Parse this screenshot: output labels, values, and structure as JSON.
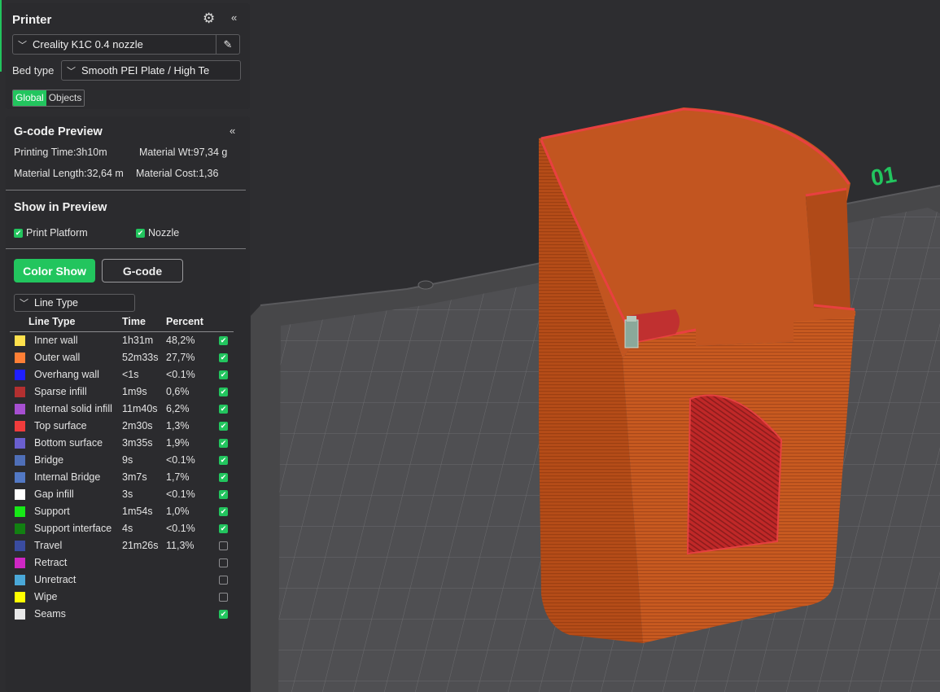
{
  "printer": {
    "title": "Printer",
    "machine": "Creality K1C 0.4 nozzle",
    "bed_type_label": "Bed type",
    "bed_type_value": "Smooth PEI Plate / High Te",
    "toggle_global": "Global",
    "toggle_objects": "Objects",
    "settings_icon": "gear-icon",
    "collapse_icon": "double-chevron-left-icon",
    "edit_icon": "pencil-icon"
  },
  "gcode": {
    "title": "G-code Preview",
    "printing_time": "Printing Time:3h10m",
    "material_wt": "Material Wt:97,34 g",
    "material_length": "Material Length:32,64 m",
    "material_cost": "Material Cost:1,36",
    "show_title": "Show in Preview",
    "print_platform": "Print Platform",
    "nozzle": "Nozzle",
    "color_show": "Color Show",
    "gcode_btn": "G-code",
    "view_select": "Line Type",
    "col_line_type": "Line Type",
    "col_time": "Time",
    "col_percent": "Percent",
    "rows": [
      {
        "name": "Inner wall",
        "time": "1h31m",
        "percent": "48,2%",
        "color": "#ffe14d",
        "checked": true
      },
      {
        "name": "Outer wall",
        "time": "52m33s",
        "percent": "27,7%",
        "color": "#ff7f36",
        "checked": true
      },
      {
        "name": "Overhang wall",
        "time": "<1s",
        "percent": "<0.1%",
        "color": "#1f1fff",
        "checked": true
      },
      {
        "name": "Sparse infill",
        "time": "1m9s",
        "percent": "0,6%",
        "color": "#b33030",
        "checked": true
      },
      {
        "name": "Internal solid infill",
        "time": "11m40s",
        "percent": "6,2%",
        "color": "#a64fd1",
        "checked": true
      },
      {
        "name": "Top surface",
        "time": "2m30s",
        "percent": "1,3%",
        "color": "#f03c3c",
        "checked": true
      },
      {
        "name": "Bottom surface",
        "time": "3m35s",
        "percent": "1,9%",
        "color": "#6a5fcf",
        "checked": true
      },
      {
        "name": "Bridge",
        "time": "9s",
        "percent": "<0.1%",
        "color": "#4f6fb8",
        "checked": true
      },
      {
        "name": "Internal Bridge",
        "time": "3m7s",
        "percent": "1,7%",
        "color": "#5278c4",
        "checked": true
      },
      {
        "name": "Gap infill",
        "time": "3s",
        "percent": "<0.1%",
        "color": "#ffffff",
        "checked": true
      },
      {
        "name": "Support",
        "time": "1m54s",
        "percent": "1,0%",
        "color": "#17e817",
        "checked": true
      },
      {
        "name": "Support interface",
        "time": "4s",
        "percent": "<0.1%",
        "color": "#128012",
        "checked": true
      },
      {
        "name": "Travel",
        "time": "21m26s",
        "percent": "11,3%",
        "color": "#3a4ca0",
        "checked": false
      },
      {
        "name": "Retract",
        "time": "",
        "percent": "",
        "color": "#cf27c4",
        "checked": false
      },
      {
        "name": "Unretract",
        "time": "",
        "percent": "",
        "color": "#4aa8d8",
        "checked": false
      },
      {
        "name": "Wipe",
        "time": "",
        "percent": "",
        "color": "#ffff00",
        "checked": false
      },
      {
        "name": "Seams",
        "time": "",
        "percent": "",
        "color": "#e8e8e8",
        "checked": true
      }
    ]
  },
  "viewport": {
    "plate_label": "01",
    "colors": {
      "model": "#b8501a",
      "accent": "#22c55e",
      "plate": "#4e4e50"
    }
  }
}
